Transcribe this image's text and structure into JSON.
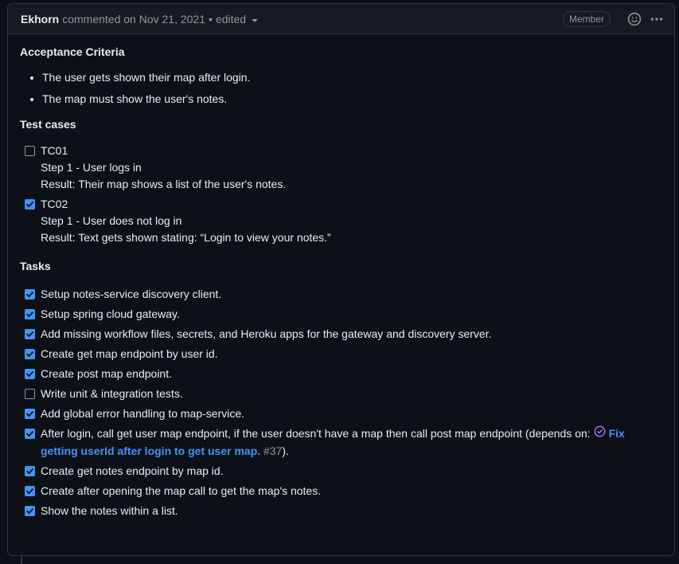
{
  "header": {
    "author": "Ekhorn",
    "action": "commented on",
    "date": "Nov 21, 2021",
    "edited": "edited",
    "badge": "Member",
    "icons": [
      "smiley-icon",
      "kebab-horizontal-icon"
    ]
  },
  "acceptance": {
    "heading": "Acceptance Criteria",
    "items": [
      "The user gets shown their map after login.",
      "The map must show the user's notes."
    ]
  },
  "test_cases": {
    "heading": "Test cases",
    "items": [
      {
        "checked": false,
        "label": "TC01",
        "step": "Step 1 - User logs in",
        "result": "Result: Their map shows a list of the user's notes."
      },
      {
        "checked": true,
        "label": "TC02",
        "step": "Step 1 - User does not log in",
        "result": "Result: Text gets shown stating: “Login to view your notes.”"
      }
    ]
  },
  "tasks": {
    "heading": "Tasks",
    "items": [
      {
        "checked": true,
        "text": "Setup notes-service discovery client."
      },
      {
        "checked": true,
        "text": "Setup spring cloud gateway."
      },
      {
        "checked": true,
        "text": "Add missing workflow files, secrets, and Heroku apps for the gateway and discovery server."
      },
      {
        "checked": true,
        "text": "Create get map endpoint by user id."
      },
      {
        "checked": true,
        "text": "Create post map endpoint."
      },
      {
        "checked": false,
        "text": "Write unit & integration tests."
      },
      {
        "checked": true,
        "text": "Add global error handling to map-service."
      },
      {
        "checked": true,
        "text": "After login, call get user map endpoint, if the user doesn't have a map then call post map endpoint (depends on: ",
        "link": "Fix getting userId after login to get user map.",
        "ref": "#37",
        "suffix": ")."
      },
      {
        "checked": true,
        "text": "Create get notes endpoint by map id."
      },
      {
        "checked": true,
        "text": "Create after opening the map call to get the map's notes."
      },
      {
        "checked": true,
        "text": "Show the notes within a list."
      }
    ]
  },
  "colors": {
    "background": "#0d1117",
    "header_bg": "#161b22",
    "border": "#30363d",
    "text": "#e6edf3",
    "muted": "#8d96a0",
    "accent": "#4493f8",
    "done_purple": "#ab7df8"
  }
}
